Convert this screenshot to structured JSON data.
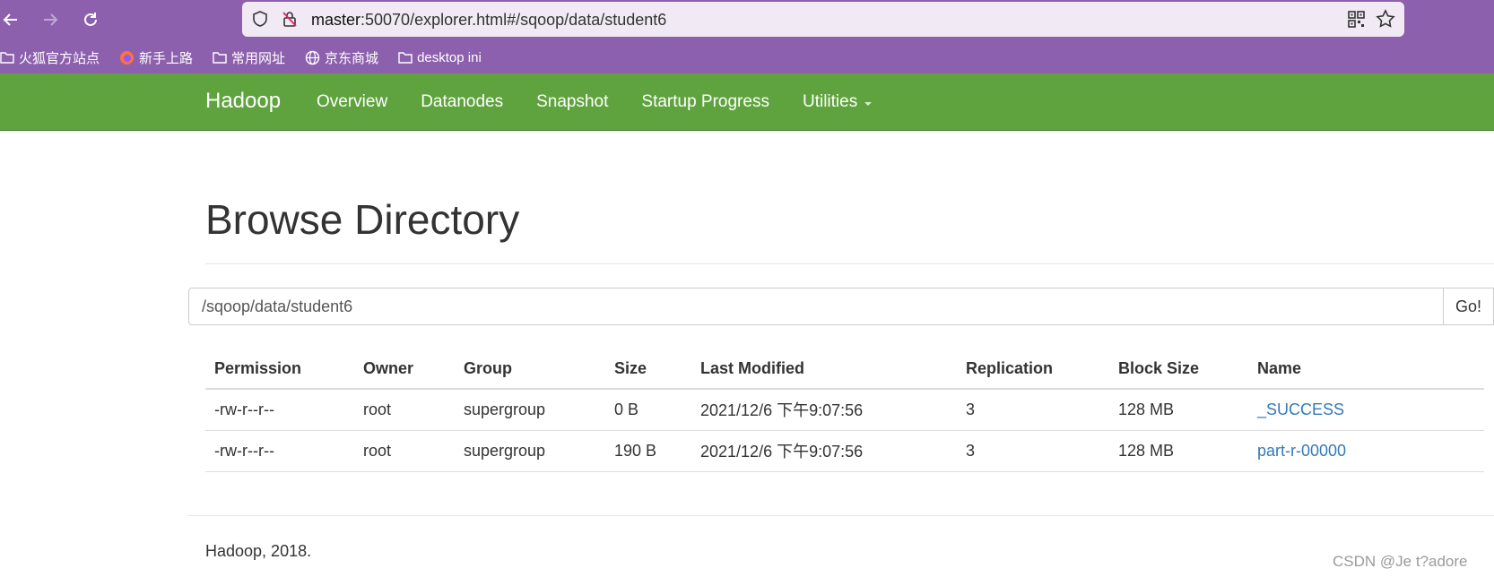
{
  "browser": {
    "url_host": "master",
    "url_rest": ":50070/explorer.html#/sqoop/data/student6",
    "bookmarks": [
      {
        "label": "火狐官方站点",
        "icon": "folder-icon"
      },
      {
        "label": "新手上路",
        "icon": "firefox-icon"
      },
      {
        "label": "常用网址",
        "icon": "folder-icon"
      },
      {
        "label": "京东商城",
        "icon": "globe-icon"
      },
      {
        "label": "desktop ini",
        "icon": "folder-icon"
      }
    ]
  },
  "navbar": {
    "brand": "Hadoop",
    "items": [
      "Overview",
      "Datanodes",
      "Snapshot",
      "Startup Progress",
      "Utilities"
    ],
    "bg_color": "#5fa33e"
  },
  "page": {
    "title": "Browse Directory",
    "path_value": "/sqoop/data/student6",
    "go_label": "Go!"
  },
  "table": {
    "headers": [
      "Permission",
      "Owner",
      "Group",
      "Size",
      "Last Modified",
      "Replication",
      "Block Size",
      "Name"
    ],
    "rows": [
      [
        "-rw-r--r--",
        "root",
        "supergroup",
        "0 B",
        "2021/12/6 下午9:07:56",
        "3",
        "128 MB",
        "_SUCCESS"
      ],
      [
        "-rw-r--r--",
        "root",
        "supergroup",
        "190 B",
        "2021/12/6 下午9:07:56",
        "3",
        "128 MB",
        "part-r-00000"
      ]
    ]
  },
  "footer": "Hadoop, 2018.",
  "watermark": "CSDN @Je t?adore"
}
